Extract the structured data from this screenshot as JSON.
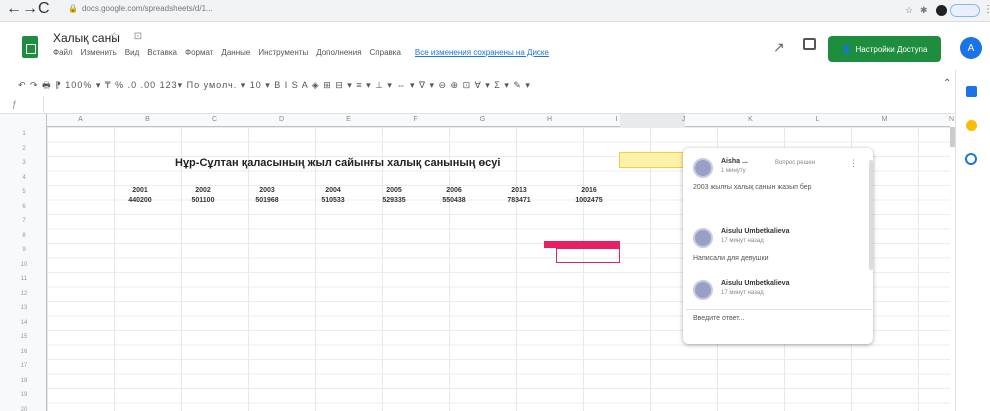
{
  "browser": {
    "url": "docs.google.com/spreadsheets/d/1...",
    "nav_back": "←",
    "nav_forward": "→",
    "nav_reload": "C",
    "menu": "⋮"
  },
  "header": {
    "title": "Халық саны",
    "share_label": "Настройки Доступа",
    "avatar_letter": "А",
    "menu": [
      "Файл",
      "Изменить",
      "Вид",
      "Вставка",
      "Формат",
      "Данные",
      "Инструменты",
      "Дополнения",
      "Справка"
    ],
    "last_edit": "Все изменения сохранены на Диске"
  },
  "toolbar": {
    "text": "↶ ↷ 🖶 ⁋  100% ▾  ₸  %  .0  .00  123▾   По умолч. ▾   10 ▾   B  I  S  A   ◈  ⊞  ⊟ ▾   ≡ ▾  ⊥ ▾  ⇔ ▾  ∇ ▾   ⊖  ⊕  ⊡  ∀ ▾  Σ ▾   ✎ ▾"
  },
  "grid": {
    "columns": [
      "A",
      "B",
      "C",
      "D",
      "E",
      "F",
      "G",
      "H",
      "I",
      "J",
      "K",
      "L",
      "M",
      "N"
    ],
    "rows": [
      "1",
      "2",
      "3",
      "4",
      "5",
      "6",
      "7",
      "8",
      "9",
      "10",
      "11",
      "12",
      "13",
      "14",
      "15",
      "16",
      "17",
      "18",
      "19",
      "20"
    ]
  },
  "sheet": {
    "title": "Нұр-Сұлтан қаласының жыл сайынғы халық санының өсуі",
    "years": [
      "2001",
      "2002",
      "2003",
      "2004",
      "2005",
      "2006",
      "2013",
      "2016"
    ],
    "values": [
      "440200",
      "501100",
      "501968",
      "510533",
      "529335",
      "550438",
      "783471",
      "1002475"
    ]
  },
  "comments": {
    "mark_done": "Вопрос решен",
    "items": [
      {
        "name": "Аіshа ...",
        "time": "1 минуту",
        "text": "2003 жылғы халық санын жазып бер"
      },
      {
        "name": "Aіsulu Umbetkalіeva",
        "time": "17 минут назад",
        "text": "Написали для девушки"
      },
      {
        "name": "Aіsulu Umbetkalіeva",
        "time": "17 минут назад",
        "text": ""
      }
    ],
    "reply_placeholder": "Введите ответ..."
  }
}
